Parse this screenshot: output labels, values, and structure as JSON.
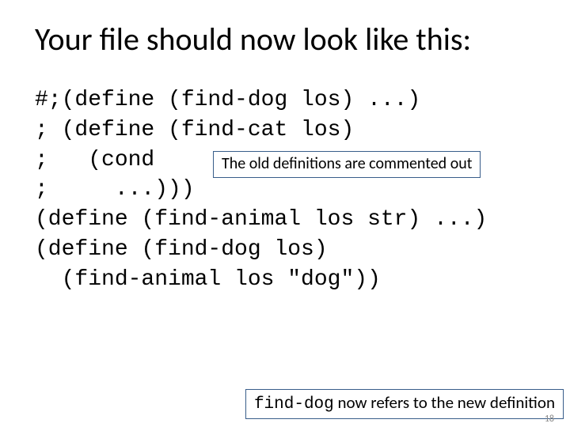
{
  "title": "Your file should now look like this:",
  "code": {
    "l1": "#;(define (find-dog los) ...)",
    "l2": "; (define (find-cat los)",
    "l3": ";   (cond",
    "l4": ";     ...)))",
    "l5": "(define (find-animal los str) ...)",
    "l6": "(define (find-dog los)",
    "l7": "  (find-animal los \"dog\"))"
  },
  "callout1": "The old definitions are commented out",
  "callout2_mono": "find-dog",
  "callout2_rest": " now refers to the new definition",
  "slide_number": "18"
}
